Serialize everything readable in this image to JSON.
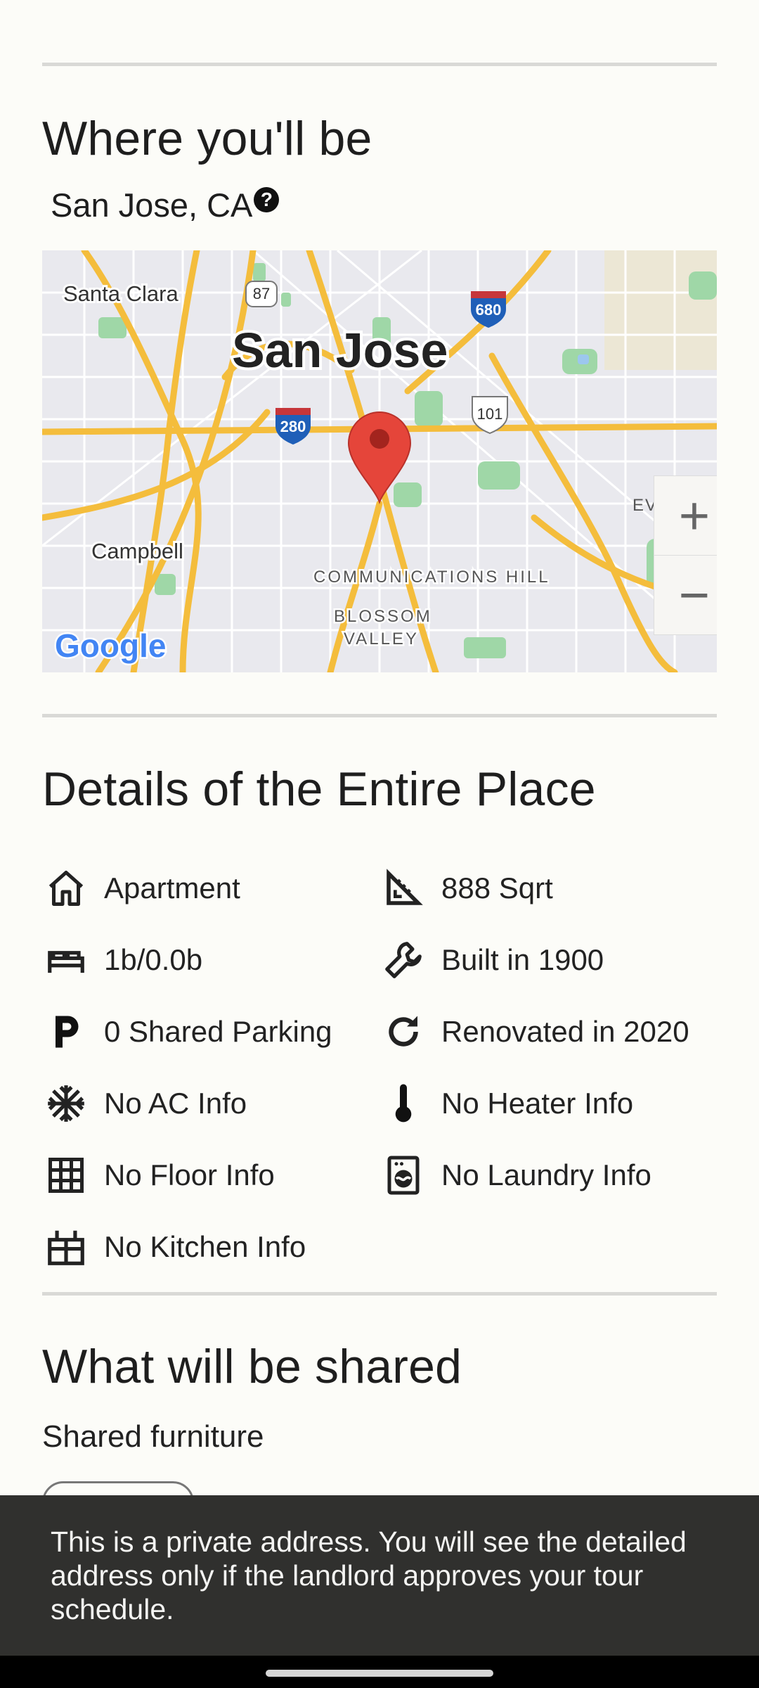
{
  "location_section": {
    "title": "Where you'll be",
    "location": "San Jose, CA",
    "help_symbol": "?",
    "map": {
      "city_label": "San Jose",
      "labels": [
        "Santa Clara",
        "Campbell",
        "COMMUNICATIONS HILL",
        "BLOSSOM",
        "VALLEY",
        "EVERGRI"
      ],
      "highway_shields": [
        "87",
        "680",
        "280",
        "101"
      ],
      "logo": "Google",
      "zoom_in": "+",
      "zoom_out": "−",
      "pin_color": "#e5453a"
    }
  },
  "details_section": {
    "title": "Details of the Entire Place",
    "items": [
      {
        "icon": "home-icon",
        "label": "Apartment"
      },
      {
        "icon": "area-ruler-icon",
        "label": "888 Sqrt"
      },
      {
        "icon": "bed-icon",
        "label": "1b/0.0b"
      },
      {
        "icon": "wrench-icon",
        "label": "Built in 1900"
      },
      {
        "icon": "parking-icon",
        "label": "0 Shared Parking"
      },
      {
        "icon": "refresh-icon",
        "label": "Renovated in 2020"
      },
      {
        "icon": "snowflake-icon",
        "label": "No AC Info"
      },
      {
        "icon": "thermometer-icon",
        "label": "No Heater Info"
      },
      {
        "icon": "floor-grid-icon",
        "label": "No Floor Info"
      },
      {
        "icon": "washer-icon",
        "label": "No Laundry Info"
      },
      {
        "icon": "kitchen-icon",
        "label": "No Kitchen Info"
      }
    ]
  },
  "shared_section": {
    "title": "What will be shared",
    "subtitle": "Shared furniture"
  },
  "snackbar": {
    "message": "This is a private address. You will see the detailed address only if the landlord approves your tour schedule."
  },
  "colors": {
    "background": "#fcfcf8",
    "snackbar": "#30302e",
    "road": "#f6c443",
    "park": "#9fd7a7"
  }
}
